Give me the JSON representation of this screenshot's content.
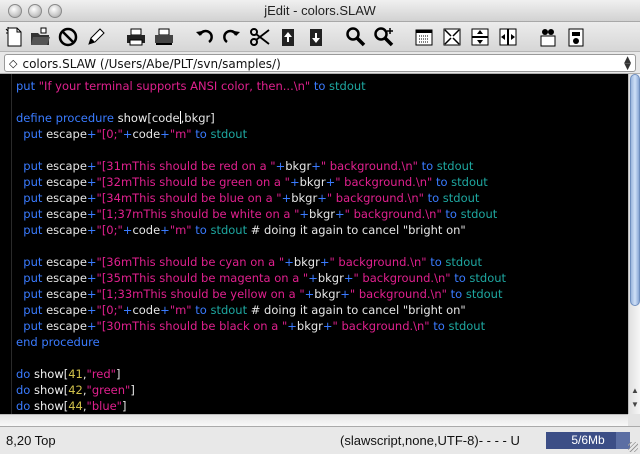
{
  "window": {
    "title": "jEdit - colors.SLAW"
  },
  "toolbar": {
    "buttons": [
      "new-file",
      "open-file",
      "close-file",
      "edit",
      "print",
      "page-setup",
      "undo",
      "redo",
      "cut",
      "copy",
      "paste",
      "find",
      "find-next",
      "new-view",
      "unsplit",
      "split-horizontal",
      "split-vertical",
      "plugin-manager",
      "global-options"
    ]
  },
  "buffer_switcher": {
    "label": "colors.SLAW (/Users/Abe/PLT/svn/samples/)"
  },
  "colors": {
    "keyword": "#3a7bff",
    "string": "#e0208e",
    "ident": "#e6e6e6",
    "function": "#f0f0f0",
    "stdout": "#1ea7a0",
    "comment": "#e6e6e6",
    "number": "#cfc04a",
    "background": "#000000"
  },
  "code_lines": [
    [
      [
        "keyword",
        "put "
      ],
      [
        "string",
        "\"If your terminal supports ANSI color, then...\\n\""
      ],
      [
        "keyword",
        " to "
      ],
      [
        "stdout",
        "stdout"
      ]
    ],
    [],
    [
      [
        "keyword",
        "define procedure "
      ],
      [
        "function",
        "show"
      ],
      [
        "ident",
        "[code"
      ],
      [
        "ident",
        "|"
      ],
      [
        "ident",
        ",bkgr]"
      ]
    ],
    [
      [
        "keyword",
        "  put "
      ],
      [
        "ident",
        "escape"
      ],
      [
        "keyword",
        "+"
      ],
      [
        "string",
        "\"[0;\""
      ],
      [
        "keyword",
        "+"
      ],
      [
        "ident",
        "code"
      ],
      [
        "keyword",
        "+"
      ],
      [
        "string",
        "\"m\""
      ],
      [
        "keyword",
        " to "
      ],
      [
        "stdout",
        "stdout"
      ]
    ],
    [],
    [
      [
        "keyword",
        "  put "
      ],
      [
        "ident",
        "escape"
      ],
      [
        "keyword",
        "+"
      ],
      [
        "string",
        "\"[31mThis should be red on a \""
      ],
      [
        "keyword",
        "+"
      ],
      [
        "ident",
        "bkgr"
      ],
      [
        "keyword",
        "+"
      ],
      [
        "string",
        "\" background.\\n\""
      ],
      [
        "keyword",
        " to "
      ],
      [
        "stdout",
        "stdout"
      ]
    ],
    [
      [
        "keyword",
        "  put "
      ],
      [
        "ident",
        "escape"
      ],
      [
        "keyword",
        "+"
      ],
      [
        "string",
        "\"[32mThis should be green on a \""
      ],
      [
        "keyword",
        "+"
      ],
      [
        "ident",
        "bkgr"
      ],
      [
        "keyword",
        "+"
      ],
      [
        "string",
        "\" background.\\n\""
      ],
      [
        "keyword",
        " to "
      ],
      [
        "stdout",
        "stdout"
      ]
    ],
    [
      [
        "keyword",
        "  put "
      ],
      [
        "ident",
        "escape"
      ],
      [
        "keyword",
        "+"
      ],
      [
        "string",
        "\"[34mThis should be blue on a \""
      ],
      [
        "keyword",
        "+"
      ],
      [
        "ident",
        "bkgr"
      ],
      [
        "keyword",
        "+"
      ],
      [
        "string",
        "\" background.\\n\""
      ],
      [
        "keyword",
        " to "
      ],
      [
        "stdout",
        "stdout"
      ]
    ],
    [
      [
        "keyword",
        "  put "
      ],
      [
        "ident",
        "escape"
      ],
      [
        "keyword",
        "+"
      ],
      [
        "string",
        "\"[1;37mThis should be white on a \""
      ],
      [
        "keyword",
        "+"
      ],
      [
        "ident",
        "bkgr"
      ],
      [
        "keyword",
        "+"
      ],
      [
        "string",
        "\" background.\\n\""
      ],
      [
        "keyword",
        " to "
      ],
      [
        "stdout",
        "stdout"
      ]
    ],
    [
      [
        "keyword",
        "  put "
      ],
      [
        "ident",
        "escape"
      ],
      [
        "keyword",
        "+"
      ],
      [
        "string",
        "\"[0;\""
      ],
      [
        "keyword",
        "+"
      ],
      [
        "ident",
        "code"
      ],
      [
        "keyword",
        "+"
      ],
      [
        "string",
        "\"m\""
      ],
      [
        "keyword",
        " to "
      ],
      [
        "stdout",
        "stdout"
      ],
      [
        "comment",
        " # doing it again to cancel \"bright on\""
      ]
    ],
    [],
    [
      [
        "keyword",
        "  put "
      ],
      [
        "ident",
        "escape"
      ],
      [
        "keyword",
        "+"
      ],
      [
        "string",
        "\"[36mThis should be cyan on a \""
      ],
      [
        "keyword",
        "+"
      ],
      [
        "ident",
        "bkgr"
      ],
      [
        "keyword",
        "+"
      ],
      [
        "string",
        "\" background.\\n\""
      ],
      [
        "keyword",
        " to "
      ],
      [
        "stdout",
        "stdout"
      ]
    ],
    [
      [
        "keyword",
        "  put "
      ],
      [
        "ident",
        "escape"
      ],
      [
        "keyword",
        "+"
      ],
      [
        "string",
        "\"[35mThis should be magenta on a \""
      ],
      [
        "keyword",
        "+"
      ],
      [
        "ident",
        "bkgr"
      ],
      [
        "keyword",
        "+"
      ],
      [
        "string",
        "\" background.\\n\""
      ],
      [
        "keyword",
        " to "
      ],
      [
        "stdout",
        "stdout"
      ]
    ],
    [
      [
        "keyword",
        "  put "
      ],
      [
        "ident",
        "escape"
      ],
      [
        "keyword",
        "+"
      ],
      [
        "string",
        "\"[1;33mThis should be yellow on a \""
      ],
      [
        "keyword",
        "+"
      ],
      [
        "ident",
        "bkgr"
      ],
      [
        "keyword",
        "+"
      ],
      [
        "string",
        "\" background.\\n\""
      ],
      [
        "keyword",
        " to "
      ],
      [
        "stdout",
        "stdout"
      ]
    ],
    [
      [
        "keyword",
        "  put "
      ],
      [
        "ident",
        "escape"
      ],
      [
        "keyword",
        "+"
      ],
      [
        "string",
        "\"[0;\""
      ],
      [
        "keyword",
        "+"
      ],
      [
        "ident",
        "code"
      ],
      [
        "keyword",
        "+"
      ],
      [
        "string",
        "\"m\""
      ],
      [
        "keyword",
        " to "
      ],
      [
        "stdout",
        "stdout"
      ],
      [
        "comment",
        " # doing it again to cancel \"bright on\""
      ]
    ],
    [
      [
        "keyword",
        "  put "
      ],
      [
        "ident",
        "escape"
      ],
      [
        "keyword",
        "+"
      ],
      [
        "string",
        "\"[30mThis should be black on a \""
      ],
      [
        "keyword",
        "+"
      ],
      [
        "ident",
        "bkgr"
      ],
      [
        "keyword",
        "+"
      ],
      [
        "string",
        "\" background.\\n\""
      ],
      [
        "keyword",
        " to "
      ],
      [
        "stdout",
        "stdout"
      ]
    ],
    [
      [
        "keyword",
        "end procedure"
      ]
    ],
    [],
    [
      [
        "keyword",
        "do "
      ],
      [
        "function",
        "show"
      ],
      [
        "ident",
        "["
      ],
      [
        "number",
        "41"
      ],
      [
        "ident",
        ","
      ],
      [
        "string",
        "\"red\""
      ],
      [
        "ident",
        "]"
      ]
    ],
    [
      [
        "keyword",
        "do "
      ],
      [
        "function",
        "show"
      ],
      [
        "ident",
        "["
      ],
      [
        "number",
        "42"
      ],
      [
        "ident",
        ","
      ],
      [
        "string",
        "\"green\""
      ],
      [
        "ident",
        "]"
      ]
    ],
    [
      [
        "keyword",
        "do "
      ],
      [
        "function",
        "show"
      ],
      [
        "ident",
        "["
      ],
      [
        "number",
        "44"
      ],
      [
        "ident",
        ","
      ],
      [
        "string",
        "\"blue\""
      ],
      [
        "ident",
        "]"
      ]
    ]
  ],
  "status": {
    "position": "8,20 Top",
    "mode": "(slawscript,none,UTF-8)- - - -  U",
    "memory": "5/6Mb",
    "memory_used_fraction": 0.83
  }
}
